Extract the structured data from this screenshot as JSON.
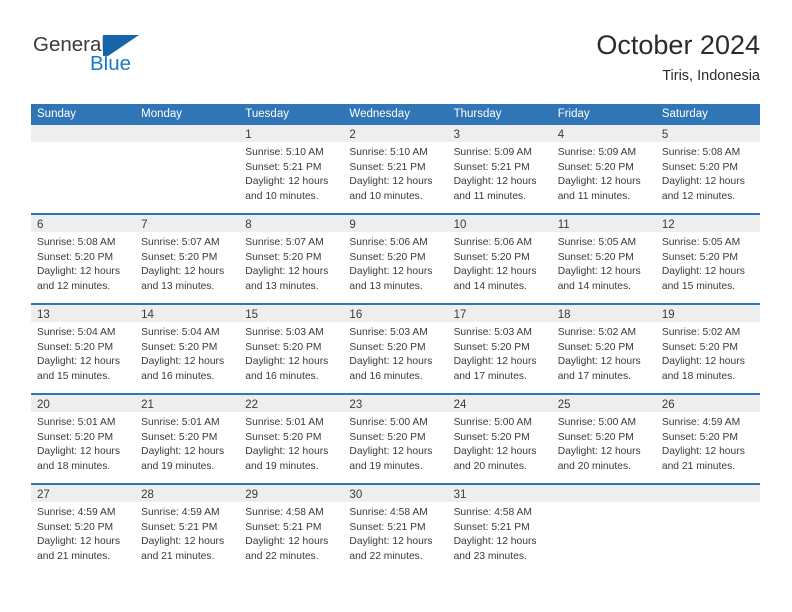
{
  "brand": {
    "name_part1": "General",
    "name_part2": "Blue",
    "logo_icon": "general-blue-flag-logo",
    "color_blue": "#1a7bc4",
    "color_dark": "#3b3b3b"
  },
  "header": {
    "month_title": "October 2024",
    "location": "Tiris, Indonesia"
  },
  "theme": {
    "header_blue": "#3075b5",
    "daynum_band": "#eeeeee",
    "text": "#3a3a3a"
  },
  "calendar": {
    "weekday_headers": [
      "Sunday",
      "Monday",
      "Tuesday",
      "Wednesday",
      "Thursday",
      "Friday",
      "Saturday"
    ],
    "weeks": [
      [
        {
          "day": "",
          "lines": []
        },
        {
          "day": "",
          "lines": []
        },
        {
          "day": "1",
          "lines": [
            "Sunrise: 5:10 AM",
            "Sunset: 5:21 PM",
            "Daylight: 12 hours",
            "and 10 minutes."
          ]
        },
        {
          "day": "2",
          "lines": [
            "Sunrise: 5:10 AM",
            "Sunset: 5:21 PM",
            "Daylight: 12 hours",
            "and 10 minutes."
          ]
        },
        {
          "day": "3",
          "lines": [
            "Sunrise: 5:09 AM",
            "Sunset: 5:21 PM",
            "Daylight: 12 hours",
            "and 11 minutes."
          ]
        },
        {
          "day": "4",
          "lines": [
            "Sunrise: 5:09 AM",
            "Sunset: 5:20 PM",
            "Daylight: 12 hours",
            "and 11 minutes."
          ]
        },
        {
          "day": "5",
          "lines": [
            "Sunrise: 5:08 AM",
            "Sunset: 5:20 PM",
            "Daylight: 12 hours",
            "and 12 minutes."
          ]
        }
      ],
      [
        {
          "day": "6",
          "lines": [
            "Sunrise: 5:08 AM",
            "Sunset: 5:20 PM",
            "Daylight: 12 hours",
            "and 12 minutes."
          ]
        },
        {
          "day": "7",
          "lines": [
            "Sunrise: 5:07 AM",
            "Sunset: 5:20 PM",
            "Daylight: 12 hours",
            "and 13 minutes."
          ]
        },
        {
          "day": "8",
          "lines": [
            "Sunrise: 5:07 AM",
            "Sunset: 5:20 PM",
            "Daylight: 12 hours",
            "and 13 minutes."
          ]
        },
        {
          "day": "9",
          "lines": [
            "Sunrise: 5:06 AM",
            "Sunset: 5:20 PM",
            "Daylight: 12 hours",
            "and 13 minutes."
          ]
        },
        {
          "day": "10",
          "lines": [
            "Sunrise: 5:06 AM",
            "Sunset: 5:20 PM",
            "Daylight: 12 hours",
            "and 14 minutes."
          ]
        },
        {
          "day": "11",
          "lines": [
            "Sunrise: 5:05 AM",
            "Sunset: 5:20 PM",
            "Daylight: 12 hours",
            "and 14 minutes."
          ]
        },
        {
          "day": "12",
          "lines": [
            "Sunrise: 5:05 AM",
            "Sunset: 5:20 PM",
            "Daylight: 12 hours",
            "and 15 minutes."
          ]
        }
      ],
      [
        {
          "day": "13",
          "lines": [
            "Sunrise: 5:04 AM",
            "Sunset: 5:20 PM",
            "Daylight: 12 hours",
            "and 15 minutes."
          ]
        },
        {
          "day": "14",
          "lines": [
            "Sunrise: 5:04 AM",
            "Sunset: 5:20 PM",
            "Daylight: 12 hours",
            "and 16 minutes."
          ]
        },
        {
          "day": "15",
          "lines": [
            "Sunrise: 5:03 AM",
            "Sunset: 5:20 PM",
            "Daylight: 12 hours",
            "and 16 minutes."
          ]
        },
        {
          "day": "16",
          "lines": [
            "Sunrise: 5:03 AM",
            "Sunset: 5:20 PM",
            "Daylight: 12 hours",
            "and 16 minutes."
          ]
        },
        {
          "day": "17",
          "lines": [
            "Sunrise: 5:03 AM",
            "Sunset: 5:20 PM",
            "Daylight: 12 hours",
            "and 17 minutes."
          ]
        },
        {
          "day": "18",
          "lines": [
            "Sunrise: 5:02 AM",
            "Sunset: 5:20 PM",
            "Daylight: 12 hours",
            "and 17 minutes."
          ]
        },
        {
          "day": "19",
          "lines": [
            "Sunrise: 5:02 AM",
            "Sunset: 5:20 PM",
            "Daylight: 12 hours",
            "and 18 minutes."
          ]
        }
      ],
      [
        {
          "day": "20",
          "lines": [
            "Sunrise: 5:01 AM",
            "Sunset: 5:20 PM",
            "Daylight: 12 hours",
            "and 18 minutes."
          ]
        },
        {
          "day": "21",
          "lines": [
            "Sunrise: 5:01 AM",
            "Sunset: 5:20 PM",
            "Daylight: 12 hours",
            "and 19 minutes."
          ]
        },
        {
          "day": "22",
          "lines": [
            "Sunrise: 5:01 AM",
            "Sunset: 5:20 PM",
            "Daylight: 12 hours",
            "and 19 minutes."
          ]
        },
        {
          "day": "23",
          "lines": [
            "Sunrise: 5:00 AM",
            "Sunset: 5:20 PM",
            "Daylight: 12 hours",
            "and 19 minutes."
          ]
        },
        {
          "day": "24",
          "lines": [
            "Sunrise: 5:00 AM",
            "Sunset: 5:20 PM",
            "Daylight: 12 hours",
            "and 20 minutes."
          ]
        },
        {
          "day": "25",
          "lines": [
            "Sunrise: 5:00 AM",
            "Sunset: 5:20 PM",
            "Daylight: 12 hours",
            "and 20 minutes."
          ]
        },
        {
          "day": "26",
          "lines": [
            "Sunrise: 4:59 AM",
            "Sunset: 5:20 PM",
            "Daylight: 12 hours",
            "and 21 minutes."
          ]
        }
      ],
      [
        {
          "day": "27",
          "lines": [
            "Sunrise: 4:59 AM",
            "Sunset: 5:20 PM",
            "Daylight: 12 hours",
            "and 21 minutes."
          ]
        },
        {
          "day": "28",
          "lines": [
            "Sunrise: 4:59 AM",
            "Sunset: 5:21 PM",
            "Daylight: 12 hours",
            "and 21 minutes."
          ]
        },
        {
          "day": "29",
          "lines": [
            "Sunrise: 4:58 AM",
            "Sunset: 5:21 PM",
            "Daylight: 12 hours",
            "and 22 minutes."
          ]
        },
        {
          "day": "30",
          "lines": [
            "Sunrise: 4:58 AM",
            "Sunset: 5:21 PM",
            "Daylight: 12 hours",
            "and 22 minutes."
          ]
        },
        {
          "day": "31",
          "lines": [
            "Sunrise: 4:58 AM",
            "Sunset: 5:21 PM",
            "Daylight: 12 hours",
            "and 23 minutes."
          ]
        },
        {
          "day": "",
          "lines": []
        },
        {
          "day": "",
          "lines": []
        }
      ]
    ]
  }
}
